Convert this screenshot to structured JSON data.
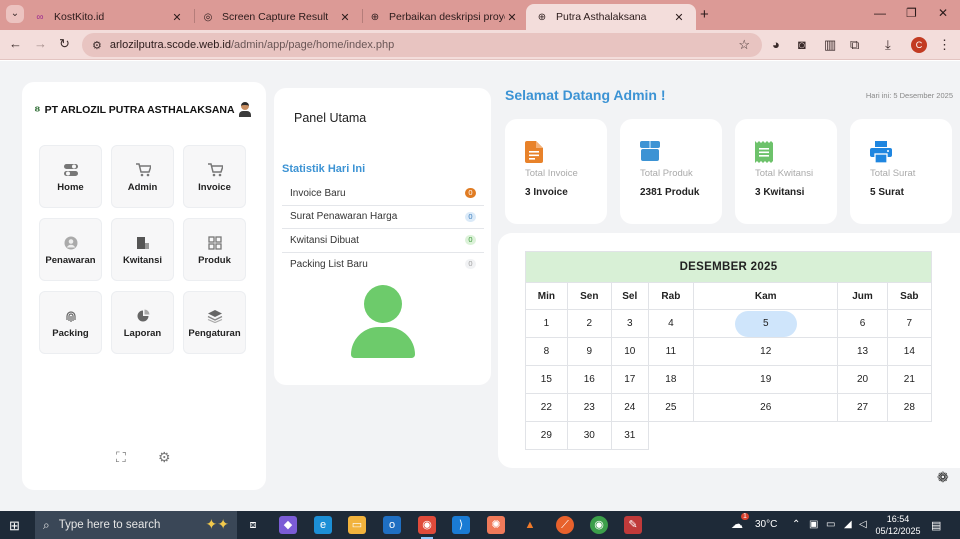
{
  "browser": {
    "tabs": [
      {
        "title": "KostKito.id",
        "icon": "kostkito-favicon"
      },
      {
        "title": "Screen Capture Result",
        "icon": "screen-capture-favicon"
      },
      {
        "title": "Perbaikan deskripsi proyek",
        "icon": "globe-favicon"
      },
      {
        "title": "Putra Asthalaksana",
        "icon": "globe-favicon",
        "active": true
      }
    ],
    "url_host": "arlozilputra.scode.web.id",
    "url_path": "/admin/app/page/home/index.php",
    "profile_initial": "C"
  },
  "sidebar": {
    "brand": "PT ARLOZIL PUTRA ASTHALAKSANA",
    "menu": [
      {
        "label": "Home",
        "icon": "toggle-icon"
      },
      {
        "label": "Admin",
        "icon": "cart-icon"
      },
      {
        "label": "Invoice",
        "icon": "cart-icon"
      },
      {
        "label": "Penawaran",
        "icon": "user-circle-icon"
      },
      {
        "label": "Kwitansi",
        "icon": "receipt-icon"
      },
      {
        "label": "Produk",
        "icon": "grid-icon"
      },
      {
        "label": "Packing",
        "icon": "fingerprint-icon"
      },
      {
        "label": "Laporan",
        "icon": "pie-chart-icon"
      },
      {
        "label": "Pengaturan",
        "icon": "layers-icon"
      }
    ]
  },
  "panel": {
    "title": "Panel Utama",
    "stats_heading": "Statistik Hari Ini",
    "stats": [
      {
        "label": "Invoice Baru",
        "count": "0",
        "bg": "#e07c23",
        "fg": "#ffffff"
      },
      {
        "label": "Surat Penawaran Harga",
        "count": "0",
        "bg": "#dbeaf8",
        "fg": "#3c7fbf"
      },
      {
        "label": "Kwitansi Dibuat",
        "count": "0",
        "bg": "#dcf2d9",
        "fg": "#3d9a3a"
      },
      {
        "label": "Packing List Baru",
        "count": "0",
        "bg": "#f1f2f4",
        "fg": "#a0a0a0"
      }
    ]
  },
  "header": {
    "welcome": "Selamat Datang Admin !",
    "date_label": "Hari ini: 5 Desember 2025"
  },
  "cards": [
    {
      "caption": "Total Invoice",
      "value": "3 Invoice",
      "icon": "invoice-file-icon",
      "color": "#e8822a"
    },
    {
      "caption": "Total Produk",
      "value": "2381 Produk",
      "icon": "box-icon",
      "color": "#3c93d4"
    },
    {
      "caption": "Total Kwitansi",
      "value": "3 Kwitansi",
      "icon": "receipt-icon",
      "color": "#6dc26b"
    },
    {
      "caption": "Total Surat",
      "value": "5 Surat",
      "icon": "printer-icon",
      "color": "#1f86e0"
    }
  ],
  "calendar": {
    "month_title": "DESEMBER 2025",
    "day_names": [
      "Min",
      "Sen",
      "Sel",
      "Rab",
      "Kam",
      "Jum",
      "Sab"
    ],
    "weeks": [
      [
        "1",
        "2",
        "3",
        "4",
        "5",
        "6",
        "7"
      ],
      [
        "8",
        "9",
        "10",
        "11",
        "12",
        "13",
        "14"
      ],
      [
        "15",
        "16",
        "17",
        "18",
        "19",
        "20",
        "21"
      ],
      [
        "22",
        "23",
        "24",
        "25",
        "26",
        "27",
        "28"
      ],
      [
        "29",
        "30",
        "31",
        "",
        "",
        "",
        ""
      ]
    ],
    "today": "5"
  },
  "taskbar": {
    "search_placeholder": "Type here to search",
    "weather": "30°C",
    "weather_badge": "1",
    "time": "16:54",
    "date": "05/12/2025"
  }
}
